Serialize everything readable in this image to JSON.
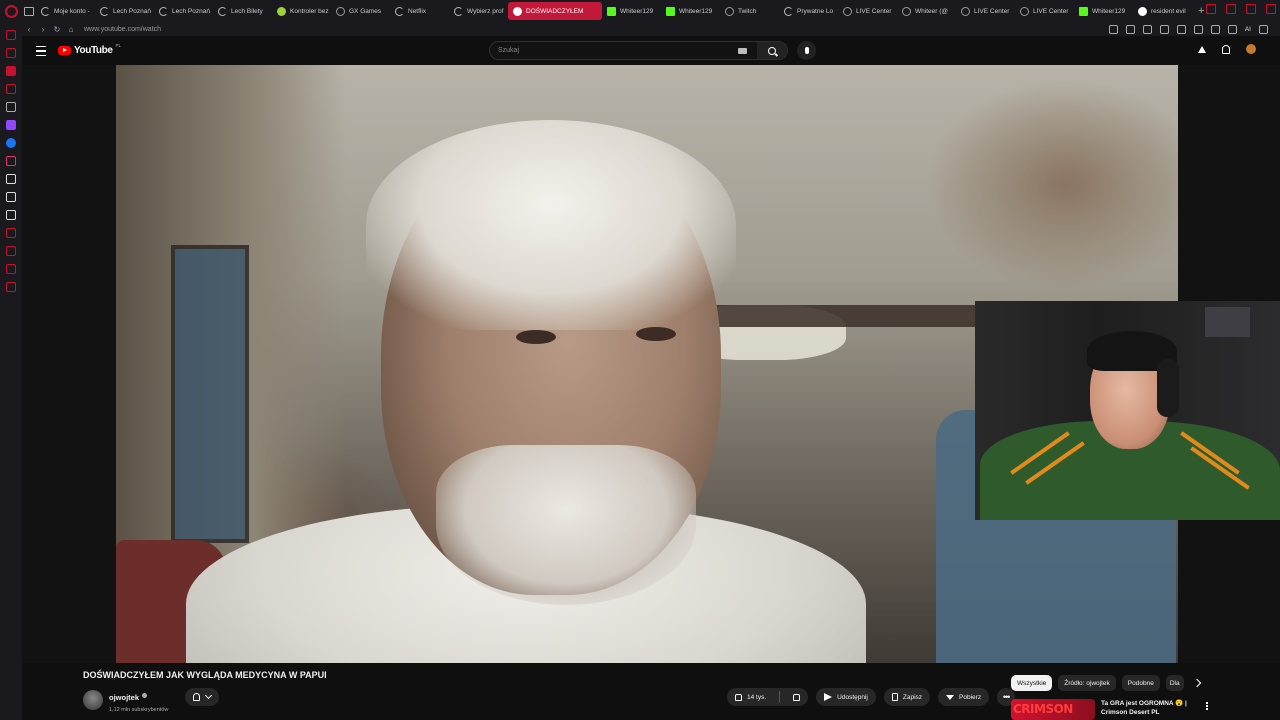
{
  "browser": {
    "tabs": [
      {
        "label": "Moje konto -",
        "fav": "spin"
      },
      {
        "label": "Lech Poznań",
        "fav": "spin"
      },
      {
        "label": "Lech Poznań",
        "fav": "spin"
      },
      {
        "label": "Lech Bilety",
        "fav": "spin"
      },
      {
        "label": "Kontroler bez",
        "fav": "lime"
      },
      {
        "label": "GX Games",
        "fav": "grey"
      },
      {
        "label": "Netflix",
        "fav": "spin"
      },
      {
        "label": "Wybierz prof",
        "fav": "spin"
      },
      {
        "label": "DOŚWIADCZYŁEM",
        "fav": "white",
        "active": true
      },
      {
        "label": "Whiteer129",
        "fav": "green"
      },
      {
        "label": "Whiteer129",
        "fav": "green"
      },
      {
        "label": "Twitch",
        "fav": "grey"
      },
      {
        "label": "Prywatne Lo",
        "fav": "spin"
      },
      {
        "label": "LIVE Center",
        "fav": "grey"
      },
      {
        "label": "Whiteer (@",
        "fav": "grey"
      },
      {
        "label": "LIVE Center",
        "fav": "grey"
      },
      {
        "label": "LIVE Center",
        "fav": "grey"
      },
      {
        "label": "Whiteer129",
        "fav": "green"
      },
      {
        "label": "resident evil",
        "fav": "white"
      }
    ],
    "new_tab": "+",
    "url": "www.youtube.com/watch",
    "ai_label": "AI"
  },
  "youtube": {
    "logo": "YouTube",
    "country": "PL",
    "search_placeholder": "Szukaj",
    "video": {
      "title": "DOŚWIADCZYŁEM JAK WYGLĄDA MEDYCYNA W PAPUI",
      "channel": "ojwojtek",
      "subscribers": "1,12 mln subskrybentów",
      "likes": "14 tys.",
      "share": "Udostępnij",
      "save": "Zapisz",
      "download": "Pobierz",
      "more": "•••"
    },
    "chips": [
      "Wszystkie",
      "Źródło: ojwojtek",
      "Podobne",
      "Dla"
    ],
    "recommended": {
      "thumb_text": "CRIMSON",
      "line1": "Ta GRA jest OGROMNA 😮 |",
      "line2": "Crimson Desert PL"
    }
  },
  "colors": {
    "accent": "#c2183a",
    "youtube_red": "#ff0000",
    "background": "#0f0f0f"
  }
}
